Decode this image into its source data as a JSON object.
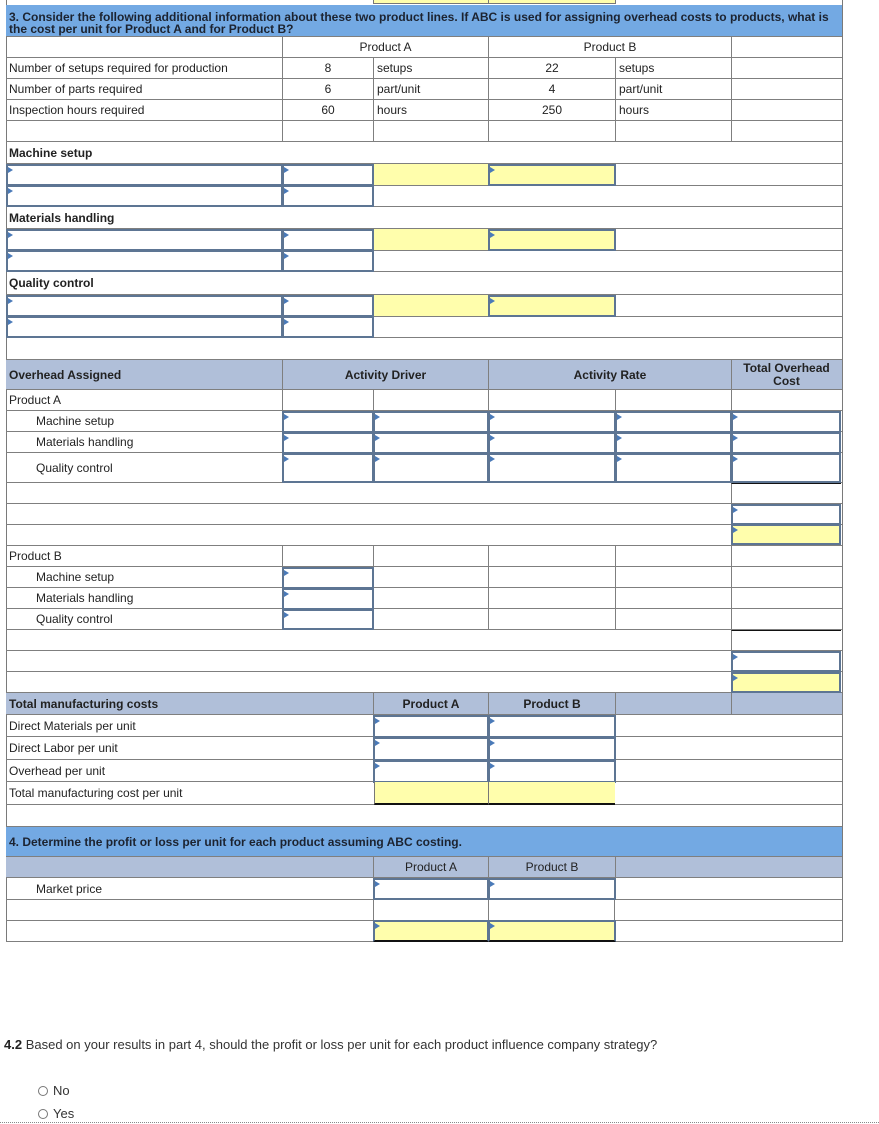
{
  "q3": {
    "prompt": "3.  Consider the following additional information about these two product lines. If ABC is used for assigning overhead costs to products, what is the cost per unit for Product A and for Product B?",
    "col_product_a": "Product A",
    "col_product_b": "Product B",
    "info_rows": [
      {
        "label": "Number of setups required for production",
        "a_value": "8",
        "a_unit": "setups",
        "b_value": "22",
        "b_unit": "setups"
      },
      {
        "label": "Number of parts required",
        "a_value": "6",
        "a_unit": "part/unit",
        "b_value": "4",
        "b_unit": "part/unit"
      },
      {
        "label": "Inspection hours required",
        "a_value": "60",
        "a_unit": "hours",
        "b_value": "250",
        "b_unit": "hours"
      }
    ],
    "activities": [
      "Machine setup",
      "Materials handling",
      "Quality control"
    ]
  },
  "overhead": {
    "header_label": "Overhead Assigned",
    "header_driver": "Activity Driver",
    "header_rate": "Activity Rate",
    "header_total": "Total Overhead Cost",
    "product_a": "Product A",
    "product_b": "Product B",
    "activities": [
      "Machine setup",
      "Materials handling",
      "Quality control"
    ]
  },
  "tmc": {
    "header": "Total manufacturing costs",
    "col_a": "Product A",
    "col_b": "Product B",
    "rows": [
      "Direct Materials per unit",
      "Direct Labor per unit",
      "Overhead per unit",
      "Total manufacturing cost per unit"
    ]
  },
  "q4": {
    "prompt": "4. Determine the profit or loss per unit for each product assuming ABC costing.",
    "col_a": "Product A",
    "col_b": "Product B",
    "market_price": "Market price"
  },
  "q42": {
    "number": "4.2",
    "prompt": " Based on your results in part 4, should the profit or loss per unit for each product influence company strategy?",
    "options": [
      "No",
      "Yes"
    ]
  }
}
